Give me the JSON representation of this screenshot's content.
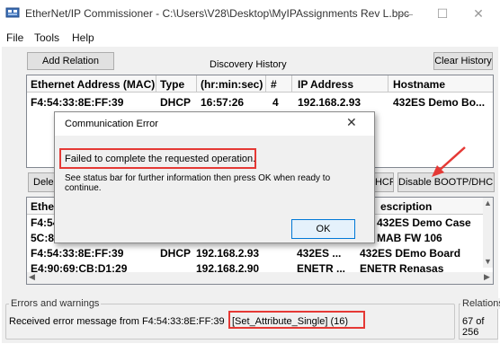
{
  "window": {
    "title": "EtherNet/IP Commissioner - C:\\Users\\V28\\Desktop\\MyIPAssignments Rev L.bpc",
    "minimize_glyph": "—",
    "maximize_glyph": "☐",
    "close_glyph": "✕"
  },
  "menu": {
    "items": [
      "File",
      "Tools",
      "Help"
    ]
  },
  "toolbar": {
    "add_relation_label": "Add Relation",
    "discovery_history_label": "Discovery History",
    "clear_history_label": "Clear History"
  },
  "discovery_table": {
    "columns": [
      "Ethernet Address (MAC)",
      "Type",
      "(hr:min:sec)",
      "#",
      "IP Address",
      "Hostname"
    ],
    "rows": [
      {
        "mac": "F4:54:33:8E:FF:39",
        "type": "DHCP",
        "time": "16:57:26",
        "count": "4",
        "ip": "192.168.2.93",
        "hostname": "432ES Demo Bo..."
      }
    ]
  },
  "middle_buttons": {
    "delete_partial": "Dele",
    "dhcp_partial": "DHCP",
    "disable_bootp_label": "Disable BOOTP/DHCP"
  },
  "relation_table": {
    "columns": [
      "Ethe",
      "escription"
    ],
    "rows": [
      {
        "mac": "F4:54",
        "type": "",
        "ip": "",
        "host": "",
        "desc": "432ES Demo Case"
      },
      {
        "mac": "5C:88",
        "type": "",
        "ip": "",
        "host": "",
        "desc": "MAB FW 106"
      },
      {
        "mac": "F4:54:33:8E:FF:39",
        "type": "DHCP",
        "ip": "192.168.2.93",
        "host": "432ES ...",
        "desc": "432ES DEmo Board"
      },
      {
        "mac": "E4:90:69:CB:D1:29",
        "type": "",
        "ip": "192.168.2.90",
        "host": "ENETR ...",
        "desc": "ENETR Renasas"
      }
    ]
  },
  "status": {
    "errors_label": "Errors and warnings",
    "message_prefix": "Received error message from F4:54:33:8E:FF:39",
    "message_highlight": "[Set_Attribute_Single] (16)",
    "relations_label": "Relations",
    "relations_count": "67 of 256"
  },
  "dialog": {
    "title": "Communication Error",
    "close_glyph": "✕",
    "message": "Failed to complete the requested operation.",
    "detail": "See status bar for further information then press OK when ready to continue.",
    "ok_label": "OK"
  },
  "colors": {
    "highlight_red": "#e53935"
  }
}
